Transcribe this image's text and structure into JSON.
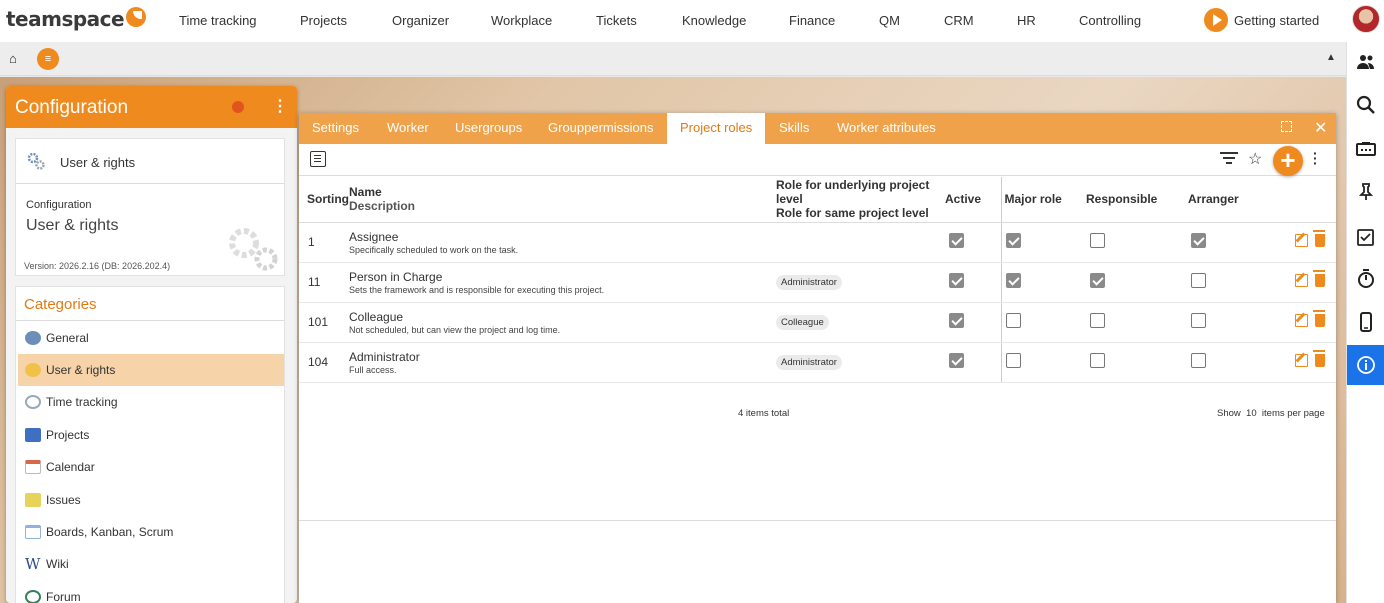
{
  "topnav": {
    "logo": "teamspace",
    "items": [
      "Time tracking",
      "Projects",
      "Organizer",
      "Workplace",
      "Tickets",
      "Knowledge",
      "Finance",
      "QM",
      "CRM",
      "HR",
      "Controlling"
    ],
    "getting_started": "Getting started"
  },
  "subbar": {
    "home_icon": "⌂",
    "menu_icon": "≡",
    "collapse_icon": "▲"
  },
  "config": {
    "title": "Configuration",
    "card_label": "User & rights",
    "section": "Configuration",
    "section_title": "User & rights",
    "version": "Version: 2026.2.16 (DB: 2026.202.4)",
    "categories_title": "Categories",
    "categories": [
      {
        "label": "General",
        "icon": "gear-icon",
        "color": "#6b8fb8"
      },
      {
        "label": "User & rights",
        "icon": "users-icon",
        "color": "#f0c24a"
      },
      {
        "label": "Time tracking",
        "icon": "stopwatch-icon",
        "color": "#9aa8b8"
      },
      {
        "label": "Projects",
        "icon": "folder-icon",
        "color": "#3f6fc2"
      },
      {
        "label": "Calendar",
        "icon": "calendar-icon",
        "color": "#d9674a"
      },
      {
        "label": "Issues",
        "icon": "sticky-note-icon",
        "color": "#e8d35a"
      },
      {
        "label": "Boards, Kanban, Scrum",
        "icon": "board-icon",
        "color": "#8fb3d9"
      },
      {
        "label": "Wiki",
        "icon": "wiki-icon",
        "color": "#2d4c8a"
      },
      {
        "label": "Forum",
        "icon": "forum-icon",
        "color": "#3a7d5a"
      }
    ],
    "selected_category": "User & rights"
  },
  "window": {
    "tabs": [
      "Settings",
      "Worker",
      "Usergroups",
      "Grouppermissions",
      "Project roles",
      "Skills",
      "Worker attributes"
    ],
    "active_tab": "Project roles",
    "close_icon": "✕",
    "star_icon": "☆",
    "add_icon": "+",
    "table": {
      "headers": {
        "sorting": "Sorting",
        "name": "Name",
        "description": "Description",
        "role_underlying": "Role for underlying project level",
        "role_same": "Role for same project level",
        "active": "Active",
        "major_role": "Major role",
        "responsible": "Responsible",
        "arranger": "Arranger"
      },
      "rows": [
        {
          "sorting": "1",
          "name": "Assignee",
          "description": "Specifically scheduled to work on the task.",
          "role": "",
          "active": true,
          "major_role": true,
          "responsible": false,
          "arranger": true
        },
        {
          "sorting": "11",
          "name": "Person in Charge",
          "description": "Sets the framework and is responsible for executing this project.",
          "role": "Administrator",
          "active": true,
          "major_role": true,
          "responsible": true,
          "arranger": false
        },
        {
          "sorting": "101",
          "name": "Colleague",
          "description": "Not scheduled, but can view the project and log time.",
          "role": "Colleague",
          "active": true,
          "major_role": false,
          "responsible": false,
          "arranger": false
        },
        {
          "sorting": "104",
          "name": "Administrator",
          "description": "Full access.",
          "role": "Administrator",
          "active": true,
          "major_role": false,
          "responsible": false,
          "arranger": false
        }
      ]
    },
    "footer": {
      "total": "4 items total",
      "show": "Show",
      "per_page_value": "10",
      "per_page_label": "items per page"
    }
  },
  "colors": {
    "accent": "#ef8a1f",
    "tabbar": "#f0a24b",
    "selected_category": "#f6d3a8",
    "rail_active": "#1a73e8"
  }
}
